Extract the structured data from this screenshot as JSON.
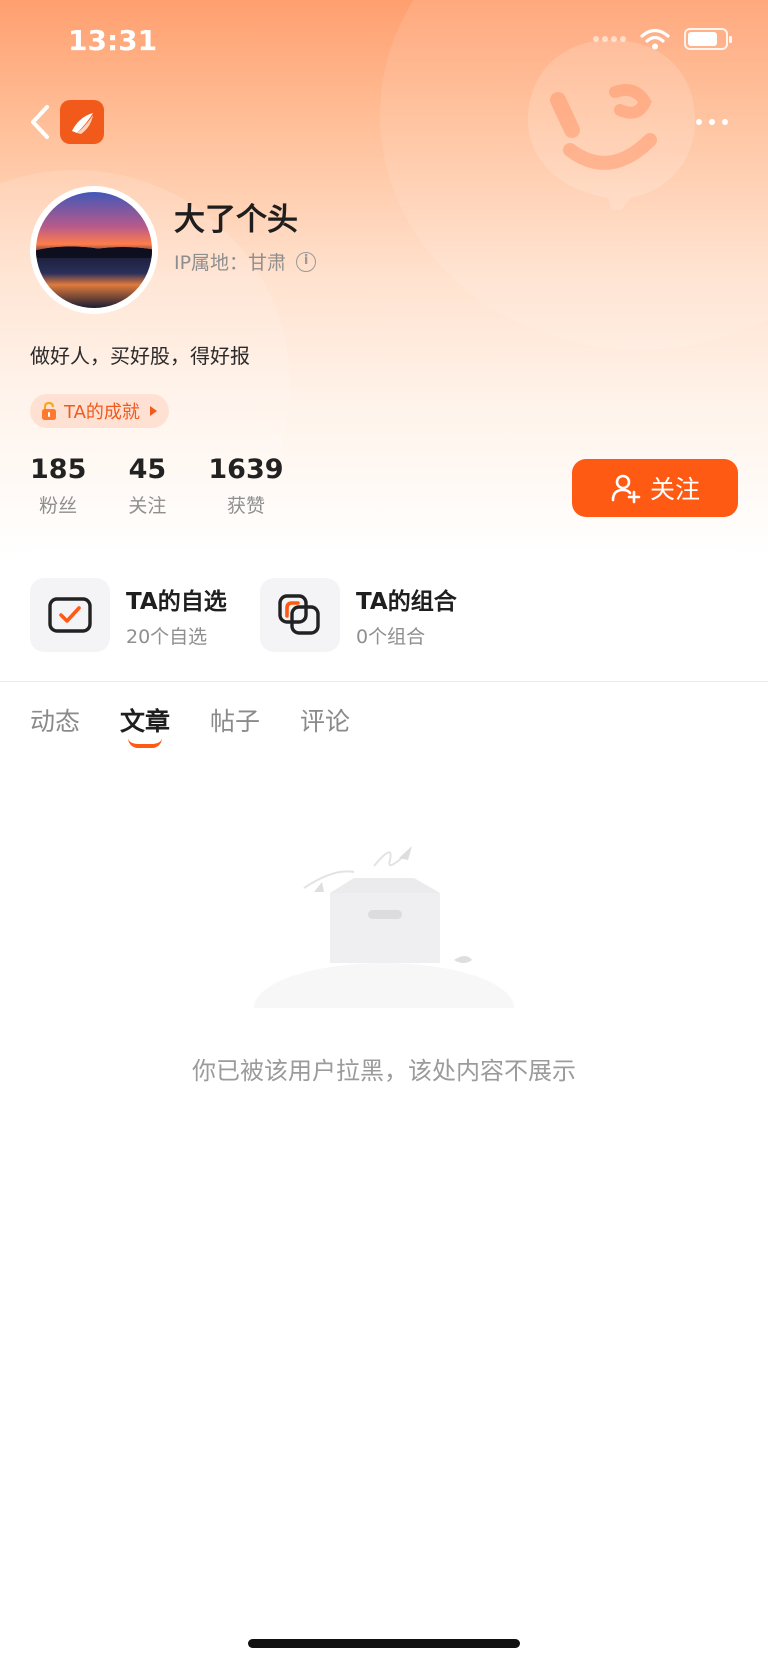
{
  "status_bar": {
    "time": "13:31"
  },
  "profile": {
    "username": "大了个头",
    "ip_location": "IP属地：甘肃",
    "bio": "做好人，买好股，得好报",
    "achievement_label": "TA的成就"
  },
  "stats": [
    {
      "value": "185",
      "label": "粉丝"
    },
    {
      "value": "45",
      "label": "关注"
    },
    {
      "value": "1639",
      "label": "获赞"
    }
  ],
  "follow_button": {
    "label": "关注"
  },
  "quick_links": [
    {
      "title": "TA的自选",
      "subtitle": "20个自选"
    },
    {
      "title": "TA的组合",
      "subtitle": "0个组合"
    }
  ],
  "tabs": [
    {
      "label": "动态"
    },
    {
      "label": "文章"
    },
    {
      "label": "帖子"
    },
    {
      "label": "评论"
    }
  ],
  "active_tab": "文章",
  "empty_state": {
    "message": "你已被该用户拉黑，该处内容不展示"
  },
  "colors": {
    "accent": "#ff5a14",
    "brand_logo": "#f25a1b"
  }
}
